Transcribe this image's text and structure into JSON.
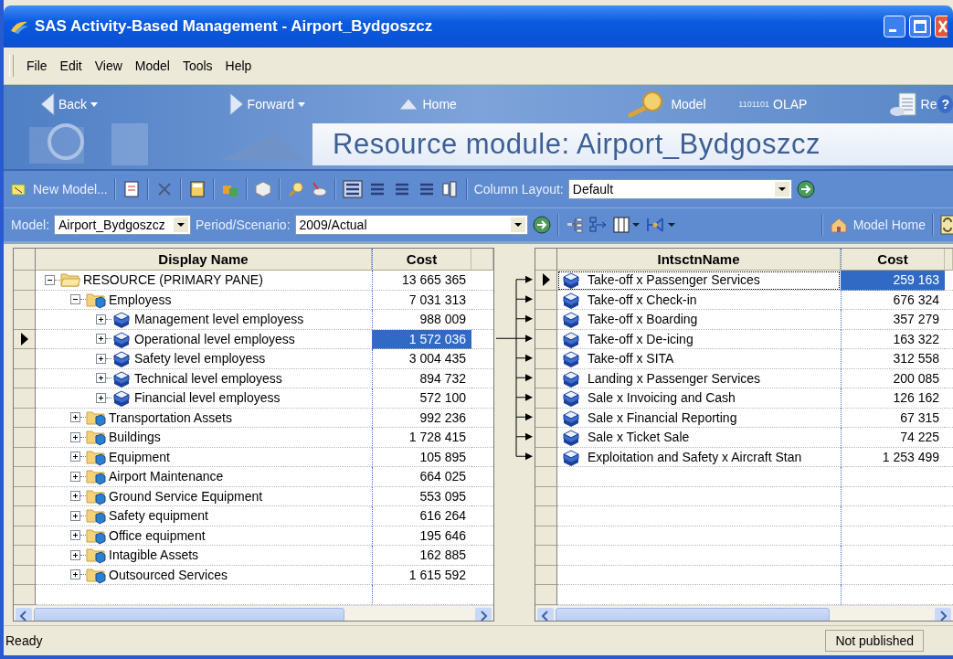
{
  "window": {
    "title": "SAS Activity-Based Management - Airport_Bydgoszcz"
  },
  "menu": [
    {
      "label": "File"
    },
    {
      "label": "Edit"
    },
    {
      "label": "View"
    },
    {
      "label": "Model"
    },
    {
      "label": "Tools"
    },
    {
      "label": "Help"
    }
  ],
  "nav": [
    {
      "kind": "back",
      "label": "Back"
    },
    {
      "kind": "forward",
      "label": "Forward"
    },
    {
      "kind": "home",
      "label": "Home"
    },
    {
      "kind": "model",
      "label": "Model"
    },
    {
      "kind": "olap",
      "label": "OLAP",
      "badge": "1101101"
    },
    {
      "kind": "reports",
      "label": "Re",
      "help": "?"
    }
  ],
  "banner_title": "Resource module: Airport_Bydgoszcz",
  "toolbar": {
    "new_model": "New Model...",
    "column_layout_label": "Column Layout:",
    "column_layout_value": "Default"
  },
  "model_bar": {
    "model_label": "Model:",
    "model_value": "Airport_Bydgoszcz",
    "period_label": "Period/Scenario:",
    "period_value": "2009/Actual",
    "home": "Model Home"
  },
  "left_grid": {
    "columns": [
      "Display Name",
      "Cost"
    ],
    "rows": [
      {
        "kind": "root",
        "name": "RESOURCE (PRIMARY PANE)",
        "cost": "13 665 365",
        "expanded": true,
        "selected": false,
        "current": false,
        "children": [
          {
            "kind": "folder",
            "name": "Employess",
            "cost": "7 031 313",
            "expanded": true,
            "selected": false,
            "current": false,
            "children": [
              {
                "kind": "resource",
                "name": "Management level employess",
                "cost": "988 009",
                "expanded": false,
                "selected": false,
                "current": false
              },
              {
                "kind": "resource",
                "name": "Operational level employess",
                "cost": "1 572 036",
                "expanded": false,
                "selected": true,
                "current": true
              },
              {
                "kind": "resource",
                "name": "Safety level employess",
                "cost": "3 004 435",
                "expanded": false,
                "selected": false,
                "current": false
              },
              {
                "kind": "resource",
                "name": "Technical level employess",
                "cost": "894 732",
                "expanded": false,
                "selected": false,
                "current": false
              },
              {
                "kind": "resource",
                "name": "Financial level employess",
                "cost": "572 100",
                "expanded": false,
                "selected": false,
                "current": false
              }
            ]
          },
          {
            "kind": "folder",
            "name": "Transportation Assets",
            "cost": "992 236",
            "expanded": false,
            "selected": false,
            "current": false
          },
          {
            "kind": "folder",
            "name": "Buildings",
            "cost": "1 728 415",
            "expanded": false,
            "selected": false,
            "current": false
          },
          {
            "kind": "folder",
            "name": "Equipment",
            "cost": "105 895",
            "expanded": false,
            "selected": false,
            "current": false
          },
          {
            "kind": "folder",
            "name": "Airport Maintenance",
            "cost": "664 025",
            "expanded": false,
            "selected": false,
            "current": false
          },
          {
            "kind": "folder",
            "name": "Ground Service Equipment",
            "cost": "553 095",
            "expanded": false,
            "selected": false,
            "current": false
          },
          {
            "kind": "folder",
            "name": "Safety equipment",
            "cost": "616 264",
            "expanded": false,
            "selected": false,
            "current": false
          },
          {
            "kind": "folder",
            "name": "Office equipment",
            "cost": "195 646",
            "expanded": false,
            "selected": false,
            "current": false
          },
          {
            "kind": "folder",
            "name": "Intagible Assets",
            "cost": "162 885",
            "expanded": false,
            "selected": false,
            "current": false
          },
          {
            "kind": "folder",
            "name": "Outsourced Services",
            "cost": "1 615 592",
            "expanded": false,
            "selected": false,
            "current": false
          }
        ]
      }
    ]
  },
  "right_grid": {
    "columns": [
      "IntsctnName",
      "Cost"
    ],
    "rows": [
      {
        "name": "Take-off x Passenger Services",
        "cost": "259 163",
        "selected": true,
        "current": true
      },
      {
        "name": "Take-off x Check-in",
        "cost": "676 324",
        "selected": false,
        "current": false
      },
      {
        "name": "Take-off x Boarding",
        "cost": "357 279",
        "selected": false,
        "current": false
      },
      {
        "name": "Take-off x De-icing",
        "cost": "163 322",
        "selected": false,
        "current": false
      },
      {
        "name": "Take-off x SITA",
        "cost": "312 558",
        "selected": false,
        "current": false
      },
      {
        "name": "Landing x Passenger Services",
        "cost": "200 085",
        "selected": false,
        "current": false
      },
      {
        "name": "Sale x Invoicing and Cash",
        "cost": "126 162",
        "selected": false,
        "current": false
      },
      {
        "name": "Sale x Financial Reporting",
        "cost": "67 315",
        "selected": false,
        "current": false
      },
      {
        "name": "Sale x Ticket Sale",
        "cost": "74 225",
        "selected": false,
        "current": false
      },
      {
        "name": "Exploitation and Safety x Aircraft Stan",
        "cost": "1 253 499",
        "selected": false,
        "current": false
      }
    ]
  },
  "status_bar": {
    "message": "Ready",
    "publish_state": "Not published"
  }
}
